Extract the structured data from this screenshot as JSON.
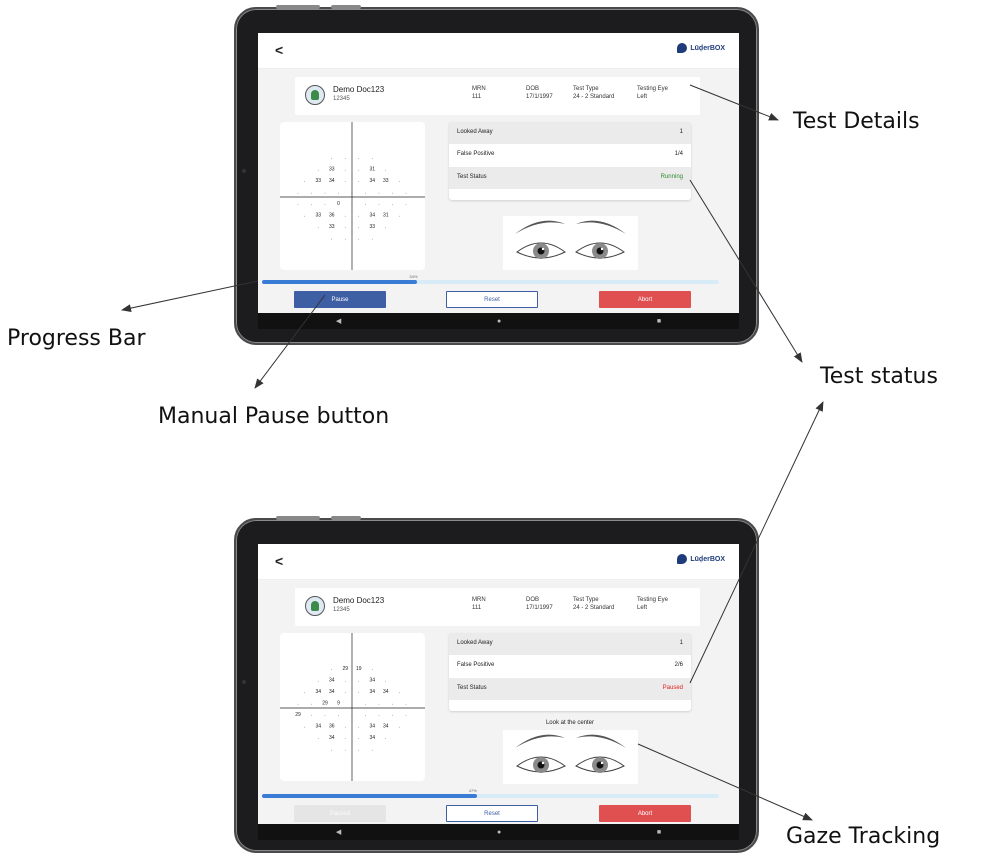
{
  "annotations": {
    "test_details": "Test Details",
    "progress_bar": "Progress Bar",
    "manual_pause": "Manual Pause button",
    "test_status": "Test status",
    "gaze_tracking": "Gaze Tracking"
  },
  "app": {
    "back_glyph": "<",
    "logo_text": "LūḑerBOX"
  },
  "patient": {
    "name": "Demo Doc123",
    "id": "12345",
    "mrn_label": "MRN",
    "mrn": "111",
    "dob_label": "DOB",
    "dob": "17/1/1997",
    "test_type_label": "Test Type",
    "test_type": "24 - 2 Standard",
    "testing_eye_label": "Testing Eye",
    "testing_eye": "Left"
  },
  "labels": {
    "looked_away": "Looked Away",
    "false_positive": "False Positive",
    "test_status": "Test Status",
    "reset": "Reset",
    "abort": "Abort",
    "pause": "Pause",
    "paused_btn": "Paused"
  },
  "screen1": {
    "looked_away": "1",
    "false_positive": "1/4",
    "status": "Running",
    "status_color": "#2e8b2e",
    "progress_pct": 34,
    "progress_label": "34%",
    "pause_enabled": true
  },
  "screen2": {
    "looked_away": "1",
    "false_positive": "2/6",
    "status": "Paused",
    "status_color": "#e02020",
    "progress_pct": 47,
    "progress_label": "47%",
    "hint": "Look at the center",
    "pause_enabled": false
  },
  "field1": {
    "rows": [
      [
        ".",
        ".",
        ".",
        "."
      ],
      [
        ".",
        "33",
        ".",
        ".",
        "31",
        "."
      ],
      [
        ".",
        "33",
        "34",
        ".",
        ".",
        "34",
        "33",
        "."
      ],
      [
        ".",
        ".",
        ".",
        ".",
        ".",
        ".",
        ".",
        ".",
        "."
      ],
      [
        ".",
        ".",
        ".",
        "0",
        ".",
        ".",
        ".",
        ".",
        "."
      ],
      [
        ".",
        "33",
        "36",
        ".",
        ".",
        "34",
        "31",
        "."
      ],
      [
        ".",
        "33",
        ".",
        ".",
        "33",
        "."
      ],
      [
        ".",
        ".",
        ".",
        "."
      ]
    ]
  },
  "field2": {
    "rows": [
      [
        ".",
        "29",
        "19",
        "."
      ],
      [
        ".",
        "34",
        ".",
        ".",
        "34",
        "."
      ],
      [
        ".",
        "34",
        "34",
        ".",
        ".",
        "34",
        "34",
        "."
      ],
      [
        ".",
        ".",
        "29",
        "9",
        ".",
        ".",
        ".",
        ".",
        "."
      ],
      [
        "29",
        ".",
        ".",
        ".",
        ".",
        ".",
        ".",
        ".",
        "."
      ],
      [
        ".",
        "34",
        "36",
        ".",
        ".",
        "34",
        "34",
        "."
      ],
      [
        ".",
        "34",
        ".",
        ".",
        "34",
        "."
      ],
      [
        ".",
        ".",
        ".",
        "."
      ]
    ]
  },
  "colors": {
    "primary": "#3f5fa5",
    "abort": "#e05050",
    "progress": "#3a7bd5"
  }
}
